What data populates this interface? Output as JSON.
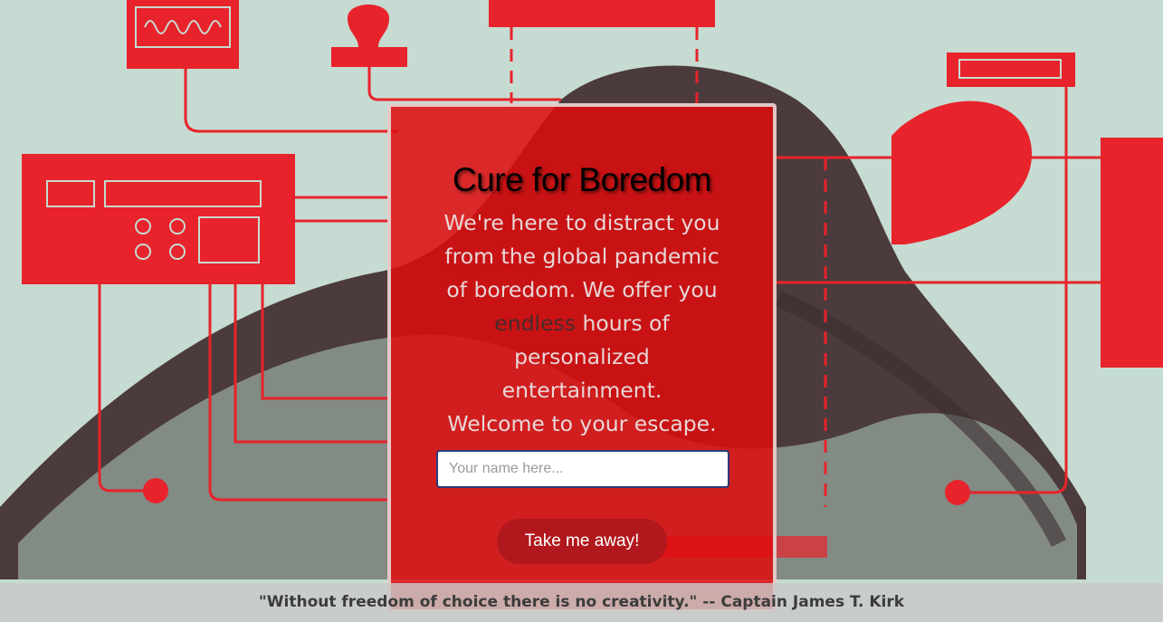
{
  "hero": {
    "title": "Cure for Boredom",
    "description_before": "We're here to distract you from the global pandemic of boredom. We offer you ",
    "description_highlight": "endless",
    "description_after": " hours of personalized entertainment.",
    "welcome": "Welcome to your escape.",
    "name_placeholder": "Your name here...",
    "name_value": "",
    "button_label": "Take me away!"
  },
  "footer": {
    "quote": "\"Without freedom of choice there is no creativity.\"",
    "separator": " -- ",
    "author": "Captain James T. Kirk"
  },
  "colors": {
    "card_background": "#de0c0e",
    "button_background": "#b1181d",
    "illustration_red": "#e8232b",
    "illustration_bg": "#c9ddd4",
    "figure_dark": "#4a3a3a"
  }
}
